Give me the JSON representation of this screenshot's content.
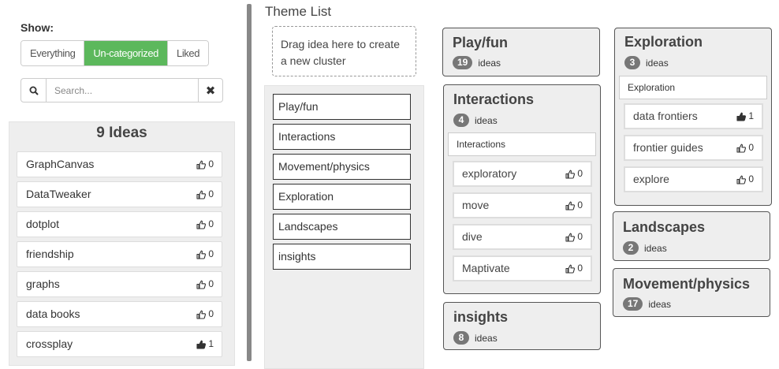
{
  "show": {
    "label": "Show:",
    "filters": [
      {
        "label": "Everything",
        "active": false
      },
      {
        "label": "Un-categorized",
        "active": true
      },
      {
        "label": "Liked",
        "active": false
      }
    ]
  },
  "search": {
    "placeholder": "Search..."
  },
  "ideas": {
    "count_label": "9 Ideas",
    "items": [
      {
        "name": "GraphCanvas",
        "likes": "0",
        "liked": false
      },
      {
        "name": "DataTweaker",
        "likes": "0",
        "liked": false
      },
      {
        "name": "dotplot",
        "likes": "0",
        "liked": false
      },
      {
        "name": "friendship",
        "likes": "0",
        "liked": false
      },
      {
        "name": "graphs",
        "likes": "0",
        "liked": false
      },
      {
        "name": "data books",
        "likes": "0",
        "liked": false
      },
      {
        "name": "crossplay",
        "likes": "1",
        "liked": true
      }
    ]
  },
  "theme_list": {
    "title": "Theme List",
    "drop_zone": "Drag idea here to create a new cluster",
    "items": [
      "Play/fun",
      "Interactions",
      "Movement/physics",
      "Exploration",
      "Landscapes",
      "insights"
    ]
  },
  "clusters": {
    "playfun": {
      "title": "Play/fun",
      "count": "19",
      "unit": "ideas"
    },
    "interactions": {
      "title": "Interactions",
      "count": "4",
      "unit": "ideas",
      "label": "Interactions",
      "ideas": [
        {
          "name": "exploratory",
          "likes": "0",
          "liked": false
        },
        {
          "name": "move",
          "likes": "0",
          "liked": false
        },
        {
          "name": "dive",
          "likes": "0",
          "liked": false
        },
        {
          "name": "Maptivate",
          "likes": "0",
          "liked": false
        }
      ]
    },
    "insights": {
      "title": "insights",
      "count": "8",
      "unit": "ideas"
    },
    "exploration": {
      "title": "Exploration",
      "count": "3",
      "unit": "ideas",
      "label": "Exploration",
      "ideas": [
        {
          "name": "data frontiers",
          "likes": "1",
          "liked": true
        },
        {
          "name": "frontier guides",
          "likes": "0",
          "liked": false
        },
        {
          "name": "explore",
          "likes": "0",
          "liked": false
        }
      ]
    },
    "landscapes": {
      "title": "Landscapes",
      "count": "2",
      "unit": "ideas"
    },
    "movement": {
      "title": "Movement/physics",
      "count": "17",
      "unit": "ideas"
    }
  },
  "colors": {
    "accent": "#5cb85c",
    "badge": "#777777",
    "panel": "#eeeeee"
  }
}
